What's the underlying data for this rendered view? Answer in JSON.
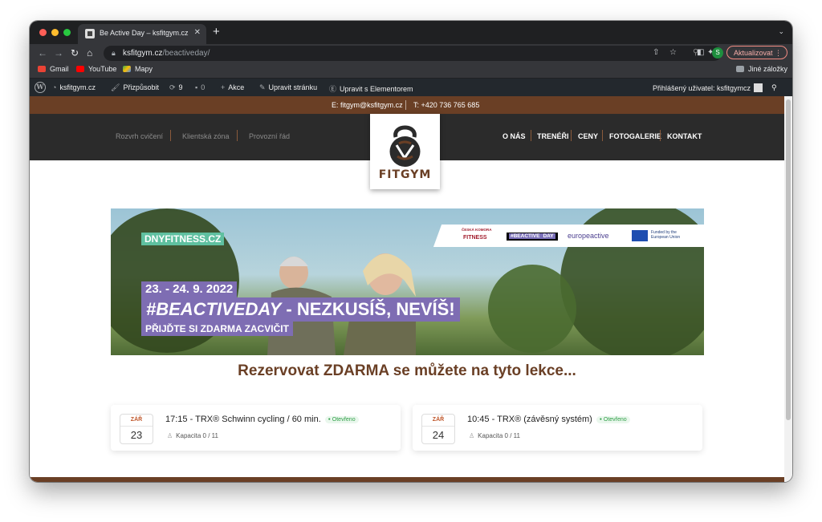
{
  "browser": {
    "tab_title": "Be Active Day – ksfitgym.cz",
    "url_host": "ksfitgym.cz",
    "url_path": "/beactiveday/",
    "profile_initial": "S",
    "update_label": "Aktualizovat",
    "bookmarks": [
      "Gmail",
      "YouTube",
      "Mapy"
    ],
    "other_bookmarks": "Jiné záložky"
  },
  "adminbar": {
    "site": "ksfitgym.cz",
    "customize": "Přizpůsobit",
    "updates_count": "9",
    "comments_count": "0",
    "new": "Akce",
    "edit_page": "Upravit stránku",
    "edit_elementor": "Upravit s Elementorem",
    "user": "Přihlášený uživatel: ksfitgymcz"
  },
  "contact": {
    "email": "E: fitgym@ksfitgym.cz",
    "phone": "T: +420 736 765 685"
  },
  "nav": {
    "left": [
      "Rozvrh cvičení",
      "Klientská zóna",
      "Provozní řád"
    ],
    "right": [
      "O NÁS",
      "TRENÉŘI",
      "CENY",
      "FOTOGALERIE",
      "KONTAKT"
    ],
    "logo_text": "FITGYM"
  },
  "banner": {
    "site_tag": "DNYFITNESS.CZ",
    "dates": "23. - 24. 9. 2022",
    "headline_hash": "#BEACTIVEDAY",
    "headline_rest": " - NEZKUSÍŠ, ",
    "headline_bold": "NEVÍŠ!",
    "subline": "PŘIJĎTE SI ZDARMA ZACVIČIT",
    "partner1_top": "ČESKÁ KOMORA",
    "partner1": "FITNESS",
    "partner2a": "#BEACTIVE",
    "partner2b": "DAY",
    "partner3": "europeactive",
    "partner4": "Funded by the European Union"
  },
  "section_heading": "Rezervovat ZDARMA se můžete na tyto lekce...",
  "lessons": [
    {
      "month": "ZÁŘ",
      "day": "23",
      "title": "17:15 - TRX® Schwinn cycling / 60 min.",
      "status": "Otevřeno",
      "capacity": "Kapacita 0 / 11"
    },
    {
      "month": "ZÁŘ",
      "day": "24",
      "title": "10:45 - TRX® (závěsný systém)",
      "status": "Otevřeno",
      "capacity": "Kapacita 0 / 11"
    }
  ],
  "colors": {
    "brand_brown": "#6a3f25",
    "header_dark": "#2b2b2b",
    "banner_purple": "#7e6db3",
    "banner_green": "#5fc0a0"
  }
}
